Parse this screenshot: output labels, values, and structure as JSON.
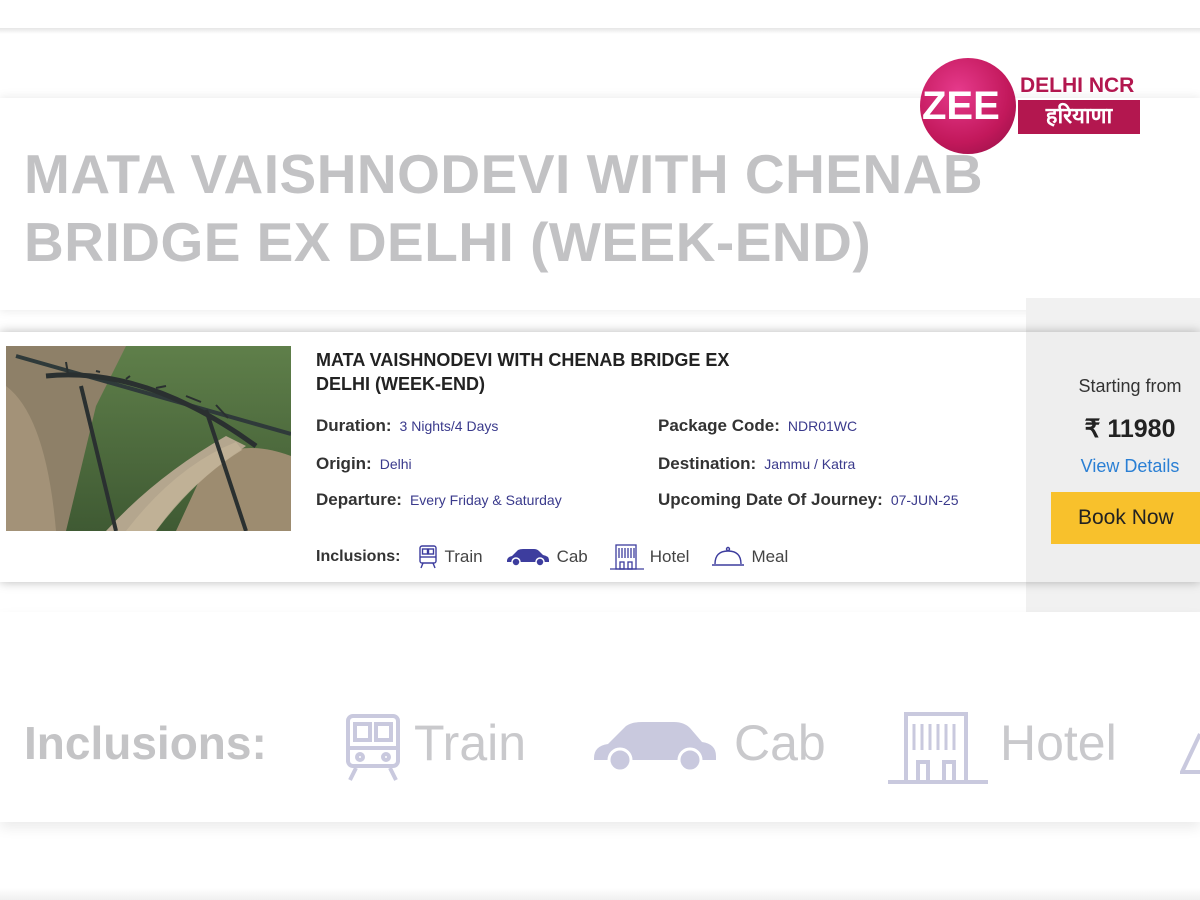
{
  "logo": {
    "brand": "ZEE",
    "region": "DELHI NCR",
    "region_hindi": "हरियाणा"
  },
  "background": {
    "title": "MATA VAISHNODEVI WITH CHENAB BRIDGE EX DELHI (WEEK-END)",
    "inclusions_label": "Inclusions:",
    "train": "Train",
    "cab": "Cab",
    "hotel": "Hotel"
  },
  "package": {
    "title": "MATA VAISHNODEVI WITH CHENAB BRIDGE EX DELHI (WEEK-END)",
    "duration_label": "Duration:",
    "duration": "3 Nights/4 Days",
    "code_label": "Package Code:",
    "code": "NDR01WC",
    "origin_label": "Origin:",
    "origin": "Delhi",
    "destination_label": "Destination:",
    "destination": "Jammu / Katra",
    "departure_label": "Departure:",
    "departure": "Every Friday & Saturday",
    "journey_label": "Upcoming Date Of Journey:",
    "journey_date": "07-JUN-25",
    "inclusions_label": "Inclusions:",
    "inclusions": [
      "Train",
      "Cab",
      "Hotel",
      "Meal"
    ]
  },
  "pricing": {
    "starting_from": "Starting from",
    "price": "₹ 11980",
    "view_details": "View Details",
    "book_now": "Book Now"
  },
  "colors": {
    "accent_button": "#f8c12c",
    "link": "#2a7fd4",
    "value_text": "#3a3a8c",
    "icon": "#3d3d9e",
    "logo": "#b3174f"
  }
}
